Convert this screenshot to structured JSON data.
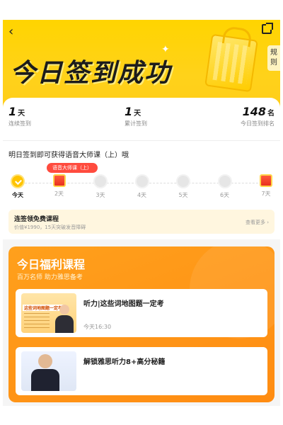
{
  "header": {
    "back_icon": "chevron-left-icon",
    "share_icon": "share-icon",
    "title": "今日签到成功",
    "rules_label": "规则"
  },
  "stats": [
    {
      "value": "1",
      "unit": "天",
      "label": "连续签到"
    },
    {
      "value": "1",
      "unit": "天",
      "label": "累计签到"
    },
    {
      "value": "148",
      "unit": "名",
      "label": "今日签到排名"
    }
  ],
  "reward": {
    "tomorrow_text": "明日签到即可获得语音大师课（上）哦",
    "badge": "语音大师课（上）"
  },
  "days": [
    {
      "label": "今天",
      "state": "done"
    },
    {
      "label": "2天",
      "state": "gift"
    },
    {
      "label": "3天",
      "state": "pending"
    },
    {
      "label": "4天",
      "state": "pending"
    },
    {
      "label": "5天",
      "state": "pending"
    },
    {
      "label": "6天",
      "state": "pending"
    },
    {
      "label": "7天",
      "state": "gift"
    }
  ],
  "free_course": {
    "title": "连签领免费课程",
    "subtitle": "价值¥1990，15天突破发音障碍",
    "more": "查看更多 ›"
  },
  "welfare": {
    "title": "今日福利课程",
    "subtitle": "百万名师 助力雅思备考",
    "lessons": [
      {
        "title": "听力|这些词地图题一定考",
        "time": "今天16:30",
        "thumb_caption": "这些词地图题一定考"
      },
      {
        "title": "解锁雅思听力8+高分秘籍",
        "time": ""
      }
    ]
  },
  "colors": {
    "brand_yellow": "#ffd400",
    "accent_orange": "#ff8c12",
    "badge_red": "#ff4b3e"
  }
}
